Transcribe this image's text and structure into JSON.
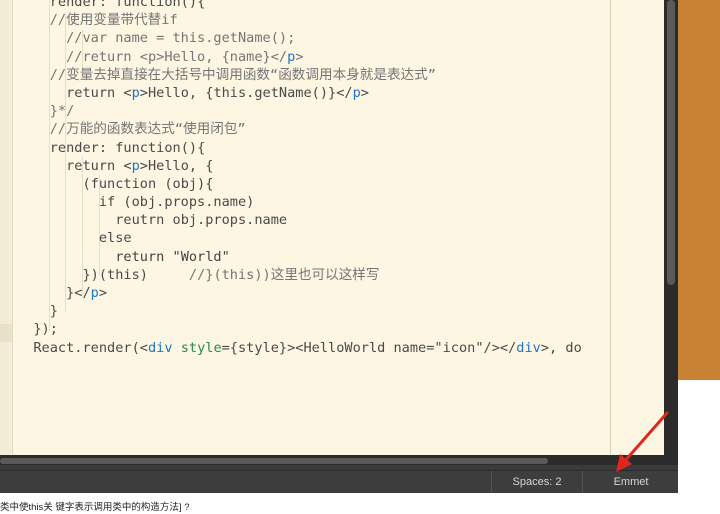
{
  "editor": {
    "code_lines": [
      {
        "indent": "    ",
        "parts": [
          {
            "t": "render: function(){",
            "c": ""
          }
        ]
      },
      {
        "indent": "    ",
        "parts": [
          {
            "t": "//使用变量带代替if",
            "c": "cm"
          }
        ]
      },
      {
        "indent": "      ",
        "parts": [
          {
            "t": "//var name = this.getName();",
            "c": "cm"
          }
        ]
      },
      {
        "indent": "      ",
        "parts": [
          {
            "t": "//return <p>Hello, {name}</",
            "c": "cm"
          },
          {
            "t": "p",
            "c": "tg"
          },
          {
            "t": ">",
            "c": "cm"
          }
        ]
      },
      {
        "indent": "    ",
        "parts": [
          {
            "t": "//变量去掉直接在大括号中调用函数“函数调用本身就是表达式”",
            "c": "cm"
          }
        ]
      },
      {
        "indent": "      ",
        "parts": [
          {
            "t": "return <",
            "c": ""
          },
          {
            "t": "p",
            "c": "tg"
          },
          {
            "t": ">Hello, {this.getName()}</",
            "c": ""
          },
          {
            "t": "p",
            "c": "tg"
          },
          {
            "t": ">",
            "c": ""
          }
        ]
      },
      {
        "indent": "    ",
        "parts": [
          {
            "t": "}*/",
            "c": "cm"
          }
        ]
      },
      {
        "indent": "    ",
        "parts": [
          {
            "t": "//万能的函数表达式“使用闭包”",
            "c": "cm"
          }
        ]
      },
      {
        "indent": "    ",
        "parts": [
          {
            "t": "render: function(){",
            "c": ""
          }
        ]
      },
      {
        "indent": "      ",
        "parts": [
          {
            "t": "return <",
            "c": ""
          },
          {
            "t": "p",
            "c": "tg"
          },
          {
            "t": ">Hello, {",
            "c": ""
          }
        ]
      },
      {
        "indent": "        ",
        "parts": [
          {
            "t": "(function (obj){",
            "c": ""
          }
        ]
      },
      {
        "indent": "          ",
        "parts": [
          {
            "t": "if (obj.props.name)",
            "c": ""
          }
        ]
      },
      {
        "indent": "            ",
        "parts": [
          {
            "t": "reutrn obj.props.name",
            "c": ""
          }
        ]
      },
      {
        "indent": "          ",
        "parts": [
          {
            "t": "else",
            "c": ""
          }
        ]
      },
      {
        "indent": "            ",
        "parts": [
          {
            "t": "return \"World\"",
            "c": "st"
          }
        ]
      },
      {
        "indent": "        ",
        "parts": [
          {
            "t": "})(this)     ",
            "c": ""
          },
          {
            "t": "//}(this))这里也可以这样写",
            "c": "cm"
          }
        ]
      },
      {
        "indent": "      ",
        "parts": [
          {
            "t": "}</",
            "c": ""
          },
          {
            "t": "p",
            "c": "tg"
          },
          {
            "t": ">",
            "c": ""
          }
        ]
      },
      {
        "indent": "    ",
        "parts": [
          {
            "t": "}",
            "c": ""
          }
        ]
      },
      {
        "indent": "  ",
        "parts": [
          {
            "t": "});",
            "c": ""
          }
        ]
      },
      {
        "indent": "  ",
        "parts": [
          {
            "t": "React.render(<",
            "c": ""
          },
          {
            "t": "div",
            "c": "tg"
          },
          {
            "t": " ",
            "c": ""
          },
          {
            "t": "style",
            "c": "at"
          },
          {
            "t": "={style}><HelloWorld name=\"icon\"/></",
            "c": ""
          },
          {
            "t": "div",
            "c": "tg"
          },
          {
            "t": ">, do",
            "c": ""
          }
        ]
      }
    ]
  },
  "statusbar": {
    "spaces_label": "Spaces: 2",
    "emmet_label": "Emmet"
  },
  "caption": {
    "text": "类中使this关 键字表示调用类中的构造方法] ?"
  },
  "colors": {
    "annotation_arrow": "#e0261e",
    "editor_bg": "#fdf6e3",
    "orange_bg": "#c98233"
  }
}
